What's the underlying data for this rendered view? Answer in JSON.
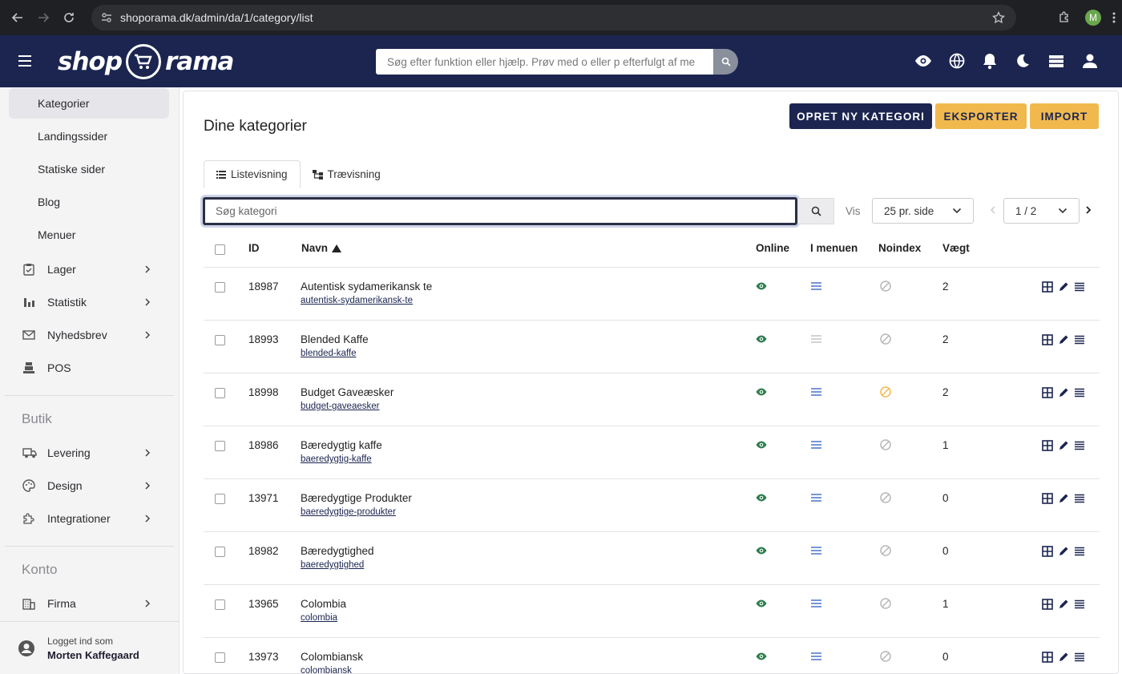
{
  "browser": {
    "url": "shoporama.dk/admin/da/1/category/list",
    "profile_initial": "M"
  },
  "header": {
    "logo_left": "shop",
    "logo_right": "rama",
    "search_placeholder": "Søg efter funktion eller hjælp. Prøv med o eller p efterfulgt af me"
  },
  "sidebar": {
    "sub_items": [
      {
        "label": "Kategorier",
        "active": true
      },
      {
        "label": "Landingssider"
      },
      {
        "label": "Statiske sider"
      },
      {
        "label": "Blog"
      },
      {
        "label": "Menuer"
      }
    ],
    "items": [
      {
        "label": "Lager",
        "icon": "clipboard-check-icon"
      },
      {
        "label": "Statistik",
        "icon": "bar-chart-icon"
      },
      {
        "label": "Nyhedsbrev",
        "icon": "mail-icon"
      },
      {
        "label": "POS",
        "icon": "pos-icon"
      }
    ],
    "section_butik": "Butik",
    "butik_items": [
      {
        "label": "Levering",
        "icon": "truck-icon"
      },
      {
        "label": "Design",
        "icon": "palette-icon"
      },
      {
        "label": "Integrationer",
        "icon": "puzzle-icon"
      }
    ],
    "section_konto": "Konto",
    "konto_items": [
      {
        "label": "Firma",
        "icon": "building-icon"
      }
    ],
    "logged_in_label": "Logget ind som",
    "user_name": "Morten Kaffegaard"
  },
  "main": {
    "title": "Dine kategorier",
    "btn_new": "OPRET NY KATEGORI",
    "btn_export": "EKSPORTER",
    "btn_import": "IMPORT",
    "tab_list": "Listevisning",
    "tab_tree": "Trævisning",
    "search_placeholder": "Søg kategori",
    "vis_label": "Vis",
    "per_page": "25 pr. side",
    "page": "1 / 2"
  },
  "table": {
    "headers": {
      "id": "ID",
      "name": "Navn",
      "online": "Online",
      "menu": "I menuen",
      "noindex": "Noindex",
      "weight": "Vægt"
    },
    "rows": [
      {
        "id": "18987",
        "name": "Autentisk sydamerikansk te",
        "slug": "autentisk-sydamerikansk-te",
        "menu": true,
        "noindex": false,
        "weight": "2"
      },
      {
        "id": "18993",
        "name": "Blended Kaffe",
        "slug": "blended-kaffe",
        "menu": false,
        "noindex": false,
        "weight": "2"
      },
      {
        "id": "18998",
        "name": "Budget Gaveæsker",
        "slug": "budget-gaveaesker",
        "menu": true,
        "noindex": true,
        "weight": "2"
      },
      {
        "id": "18986",
        "name": "Bæredygtig kaffe",
        "slug": "baeredygtig-kaffe",
        "menu": true,
        "noindex": false,
        "weight": "1"
      },
      {
        "id": "13971",
        "name": "Bæredygtige Produkter",
        "slug": "baeredygtige-produkter",
        "menu": true,
        "noindex": false,
        "weight": "0"
      },
      {
        "id": "18982",
        "name": "Bæredygtighed",
        "slug": "baeredygtighed",
        "menu": true,
        "noindex": false,
        "weight": "0"
      },
      {
        "id": "13965",
        "name": "Colombia",
        "slug": "colombia",
        "menu": true,
        "noindex": false,
        "weight": "1"
      },
      {
        "id": "13973",
        "name": "Colombiansk",
        "slug": "colombiansk",
        "menu": true,
        "noindex": false,
        "weight": "0"
      }
    ]
  },
  "colors": {
    "navy": "#1b2550",
    "accent": "#f1b94d",
    "online": "#2e7d4f",
    "menu_on": "#4a73c9",
    "menu_off": "#c4c4c8",
    "noindex_off": "#b8b8bc",
    "noindex_on": "#f1b94d"
  }
}
